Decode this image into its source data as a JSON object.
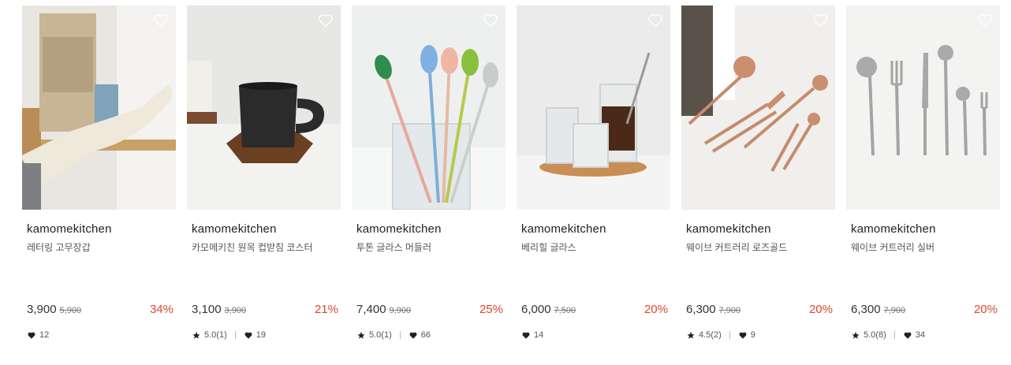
{
  "products": [
    {
      "brand": "kamomekitchen",
      "name": "레터링 고무장갑",
      "price": "3,900",
      "original_price": "5,900",
      "discount": "34%",
      "rating": "",
      "likes": "12",
      "image": "rubber-glove-photo"
    },
    {
      "brand": "kamomekitchen",
      "name": "카모메키친 원목 컵받침 코스터",
      "price": "3,100",
      "original_price": "3,900",
      "discount": "21%",
      "rating": "5.0(1)",
      "likes": "19",
      "image": "mug-on-coaster-photo"
    },
    {
      "brand": "kamomekitchen",
      "name": "투톤 글라스 머들러",
      "price": "7,400",
      "original_price": "9,900",
      "discount": "25%",
      "rating": "5.0(1)",
      "likes": "66",
      "image": "glass-muddlers-photo"
    },
    {
      "brand": "kamomekitchen",
      "name": "베리힐 글라스",
      "price": "6,000",
      "original_price": "7,500",
      "discount": "20%",
      "rating": "",
      "likes": "14",
      "image": "glass-cups-photo"
    },
    {
      "brand": "kamomekitchen",
      "name": "웨이브 커트러리 로즈골드",
      "price": "6,300",
      "original_price": "7,900",
      "discount": "20%",
      "rating": "4.5(2)",
      "likes": "9",
      "image": "rose-gold-cutlery-photo"
    },
    {
      "brand": "kamomekitchen",
      "name": "웨이브 커트러리 실버",
      "price": "6,300",
      "original_price": "7,900",
      "discount": "20%",
      "rating": "5.0(8)",
      "likes": "34",
      "image": "silver-cutlery-photo"
    }
  ],
  "colors": {
    "discount": "#e0452f",
    "text": "#333333",
    "muted": "#777777"
  }
}
